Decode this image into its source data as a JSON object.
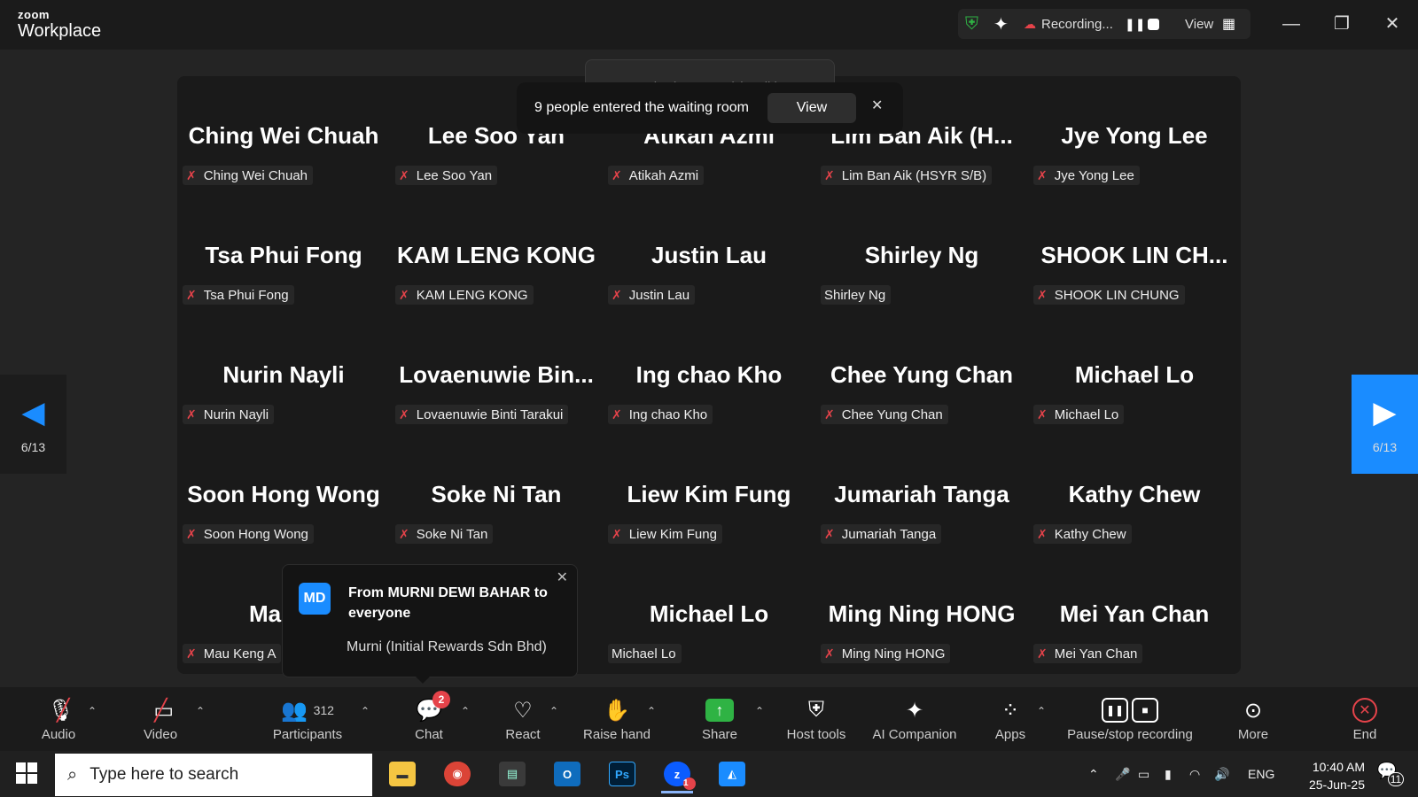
{
  "app": {
    "brand_top": "zoom",
    "brand_bottom": "Workplace"
  },
  "recording": {
    "status": "Recording...",
    "view_label": "View"
  },
  "gallery": {
    "page_indicator": "6/13",
    "tiles": [
      {
        "display": "Ching Wei Chuah",
        "label": "Ching Wei Chuah",
        "muted": true
      },
      {
        "display": "Lee Soo Yan",
        "label": "Lee Soo Yan",
        "muted": true
      },
      {
        "display": "Atikah Azmi",
        "label": "Atikah Azmi",
        "muted": true
      },
      {
        "display": "Lim Ban Aik (H...",
        "label": "Lim Ban Aik (HSYR S/B)",
        "muted": true
      },
      {
        "display": "Jye Yong Lee",
        "label": "Jye Yong Lee",
        "muted": true
      },
      {
        "display": "Tsa Phui Fong",
        "label": "Tsa Phui Fong",
        "muted": true
      },
      {
        "display": "KAM LENG KONG",
        "label": "KAM LENG KONG",
        "muted": true
      },
      {
        "display": "Justin Lau",
        "label": "Justin Lau",
        "muted": true
      },
      {
        "display": "Shirley Ng",
        "label": "Shirley Ng",
        "muted": false
      },
      {
        "display": "SHOOK LIN CH...",
        "label": "SHOOK LIN CHUNG",
        "muted": true
      },
      {
        "display": "Nurin Nayli",
        "label": "Nurin Nayli",
        "muted": true
      },
      {
        "display": "Lovaenuwie Bin...",
        "label": "Lovaenuwie Binti Tarakui",
        "muted": true
      },
      {
        "display": "Ing chao Kho",
        "label": "Ing chao Kho",
        "muted": true
      },
      {
        "display": "Chee Yung Chan",
        "label": "Chee Yung Chan",
        "muted": true
      },
      {
        "display": "Michael Lo",
        "label": "Michael Lo",
        "muted": true
      },
      {
        "display": "Soon Hong Wong",
        "label": "Soon Hong Wong",
        "muted": true
      },
      {
        "display": "Soke Ni Tan",
        "label": "Soke Ni Tan",
        "muted": true
      },
      {
        "display": "Liew Kim Fung",
        "label": "Liew Kim Fung",
        "muted": true
      },
      {
        "display": "Jumariah Tanga",
        "label": "Jumariah Tanga",
        "muted": true
      },
      {
        "display": "Kathy Chew",
        "label": "Kathy Chew",
        "muted": true
      },
      {
        "display": "Mau K",
        "label": "Mau Keng A",
        "muted": true
      },
      {
        "display": "",
        "label": "",
        "muted": false
      },
      {
        "display": "Michael Lo",
        "label": "Michael Lo",
        "muted": false
      },
      {
        "display": "Ming Ning HONG",
        "label": "Ming Ning HONG",
        "muted": true
      },
      {
        "display": "Mei Yan Chan",
        "label": "Mei Yan Chan",
        "muted": true
      }
    ]
  },
  "talking_toast": {
    "text": "Secretariat (SOPPOA) is talking..."
  },
  "waiting_toast": {
    "message": "9 people entered the waiting room",
    "view_button": "View",
    "close": "✕"
  },
  "chat_popup": {
    "avatar": "MD",
    "from": "From MURNI DEWI BAHAR to everyone",
    "message": "Murni (Initial Rewards Sdn Bhd)"
  },
  "toolbar": {
    "audio": "Audio",
    "video": "Video",
    "participants": "Participants",
    "participants_count": "312",
    "chat": "Chat",
    "chat_badge": "2",
    "react": "React",
    "raise_hand": "Raise hand",
    "share": "Share",
    "host_tools": "Host tools",
    "ai_companion": "AI Companion",
    "apps": "Apps",
    "pause_stop": "Pause/stop recording",
    "more": "More",
    "end": "End"
  },
  "taskbar": {
    "search_placeholder": "Type here to search",
    "language": "ENG",
    "time": "10:40 AM",
    "date": "25-Jun-25",
    "notifications": "11",
    "zoom_badge": "1"
  },
  "colors": {
    "accent": "#1a8cff",
    "muted_red": "#e5434a",
    "share_green": "#2fb344"
  }
}
